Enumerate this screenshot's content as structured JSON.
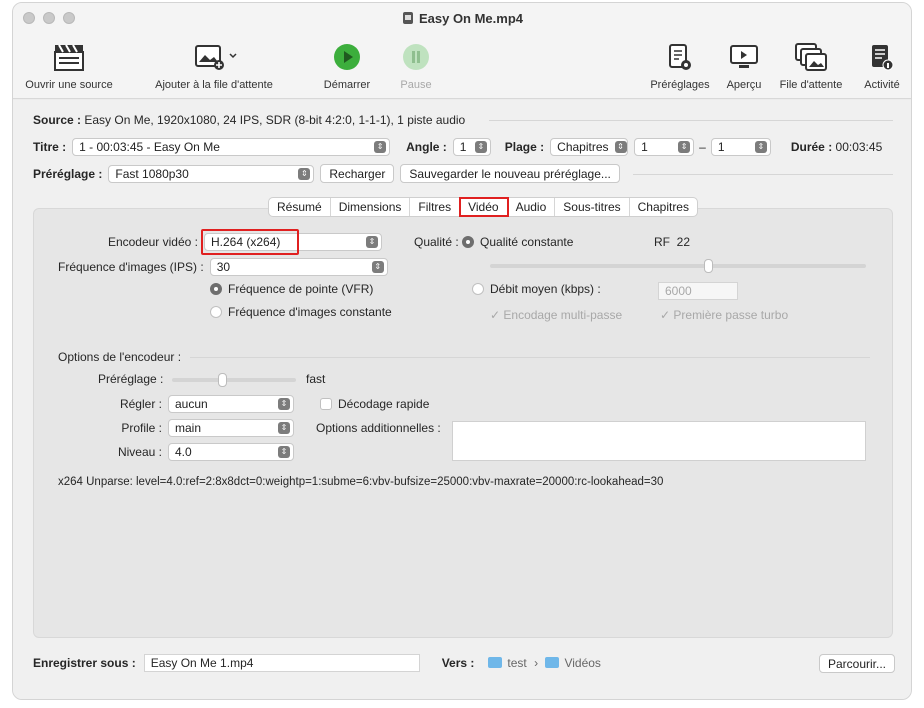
{
  "window": {
    "title": "Easy On Me.mp4"
  },
  "toolbar": {
    "open_source": "Ouvrir une source",
    "add_queue": "Ajouter à la file d'attente",
    "start": "Démarrer",
    "pause": "Pause",
    "presets": "Préréglages",
    "preview": "Aperçu",
    "queue": "File d'attente",
    "activity": "Activité"
  },
  "source": {
    "label": "Source :",
    "value": "Easy On Me, 1920x1080, 24 IPS, SDR (8-bit 4:2:0, 1-1-1), 1 piste audio"
  },
  "title_row": {
    "label": "Titre :",
    "value": "1 - 00:03:45 - Easy On Me",
    "angle_label": "Angle :",
    "angle_value": "1",
    "range_label": "Plage :",
    "range_value": "Chapitres",
    "range_from": "1",
    "range_sep": "–",
    "range_to": "1",
    "duration_label": "Durée :",
    "duration_value": "00:03:45"
  },
  "preset_row": {
    "label": "Préréglage :",
    "value": "Fast 1080p30",
    "reload": "Recharger",
    "save_new": "Sauvegarder le nouveau préréglage..."
  },
  "tabs": [
    "Résumé",
    "Dimensions",
    "Filtres",
    "Vidéo",
    "Audio",
    "Sous-titres",
    "Chapitres"
  ],
  "video": {
    "encoder_label": "Encodeur vidéo :",
    "encoder_value": "H.264 (x264)",
    "fps_label": "Fréquence d'images (IPS) :",
    "fps_value": "30",
    "vfr": "Fréquence de pointe (VFR)",
    "cfr": "Fréquence d'images constante",
    "quality_label": "Qualité :",
    "constant_quality": "Qualité constante",
    "rf_label": "RF",
    "rf_value": "22",
    "rf_slider_fraction": 0.58,
    "avg_bitrate": "Débit moyen (kbps) :",
    "bitrate_value": "6000",
    "multipass": "Encodage multi-passe",
    "turbo": "Première passe turbo",
    "encoder_options": "Options de l'encodeur :",
    "preset_label": "Préréglage :",
    "preset_value": "fast",
    "preset_slider_fraction": 0.4,
    "tune_label": "Régler :",
    "tune_value": "aucun",
    "fast_decode": "Décodage rapide",
    "profile_label": "Profile :",
    "profile_value": "main",
    "extra_options": "Options additionnelles :",
    "level_label": "Niveau :",
    "level_value": "4.0",
    "unparse": "x264 Unparse: level=4.0:ref=2:8x8dct=0:weightp=1:subme=6:vbv-bufsize=25000:vbv-maxrate=20000:rc-lookahead=30"
  },
  "save_row": {
    "label": "Enregistrer sous :",
    "value": "Easy On Me 1.mp4",
    "to_label": "Vers :",
    "folder1": "test",
    "sep": "›",
    "folder2": "Vidéos",
    "browse": "Parcourir..."
  },
  "colors": {
    "highlight": "#e02020",
    "start_green": "#3cae3c",
    "folder": "#6fb7e9"
  }
}
